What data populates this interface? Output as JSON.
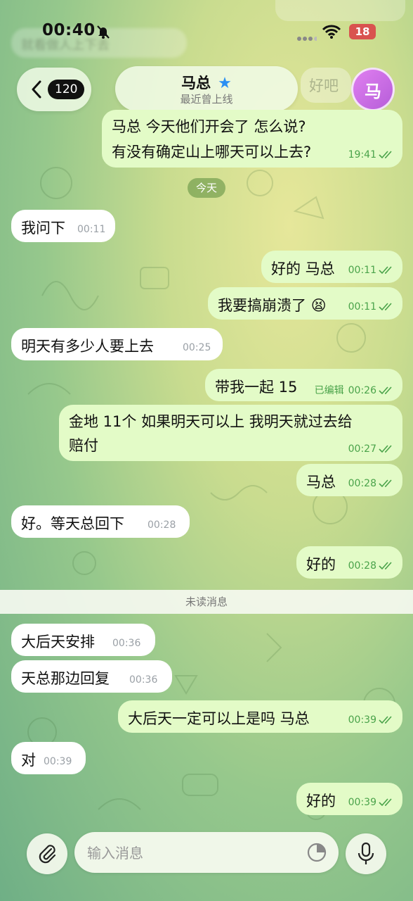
{
  "status_bar": {
    "time": "00:40",
    "battery": "18"
  },
  "ghost": {
    "top_left": "就看做人上下去",
    "right_preview": "好吧"
  },
  "header": {
    "back_count": "120",
    "contact_name": "马总",
    "status": "最近曾上线",
    "avatar_letter": "马"
  },
  "messages": [
    {
      "dir": "out",
      "text": "马总 今天他们开会了 怎么说?",
      "text2": "有没有确定山上哪天可以上去?",
      "time": "19:41"
    },
    {
      "dir": "in",
      "text": "我问下",
      "time": "00:11"
    },
    {
      "dir": "out",
      "text": "好的 马总",
      "time": "00:11"
    },
    {
      "dir": "out",
      "text": "我要搞崩溃了",
      "emoji": "😫",
      "time": "00:11"
    },
    {
      "dir": "in",
      "text": "明天有多少人要上去",
      "time": "00:25"
    },
    {
      "dir": "out",
      "text": "带我一起 15",
      "edited": "已编辑",
      "time": "00:26"
    },
    {
      "dir": "out",
      "text": "金地 11个 如果明天可以上 我明天就过去给",
      "text2": "赔付",
      "time": "00:27"
    },
    {
      "dir": "out",
      "text": "马总",
      "time": "00:28"
    },
    {
      "dir": "in",
      "text": "好。等天总回下",
      "time": "00:28"
    },
    {
      "dir": "out",
      "text": "好的",
      "time": "00:28"
    },
    {
      "dir": "in",
      "text": "大后天安排",
      "time": "00:36"
    },
    {
      "dir": "in",
      "text": "天总那边回复",
      "time": "00:36"
    },
    {
      "dir": "out",
      "text": "大后天一定可以上是吗 马总",
      "time": "00:39"
    },
    {
      "dir": "in",
      "text": "对",
      "time": "00:39"
    },
    {
      "dir": "out",
      "text": "好的",
      "time": "00:39"
    }
  ],
  "date_separator": "今天",
  "unread_label": "未读消息",
  "composer": {
    "placeholder": "输入消息"
  },
  "colors": {
    "outgoing_bubble": "#e3fbc7",
    "incoming_bubble": "#ffffff",
    "check_green": "#4aa34a",
    "star_blue": "#2b8ff3"
  },
  "icons": [
    "bell-slash-icon",
    "wifi-icon",
    "chevron-left-icon",
    "star-icon",
    "paperclip-icon",
    "sticker-icon",
    "microphone-icon",
    "double-check-icon"
  ]
}
